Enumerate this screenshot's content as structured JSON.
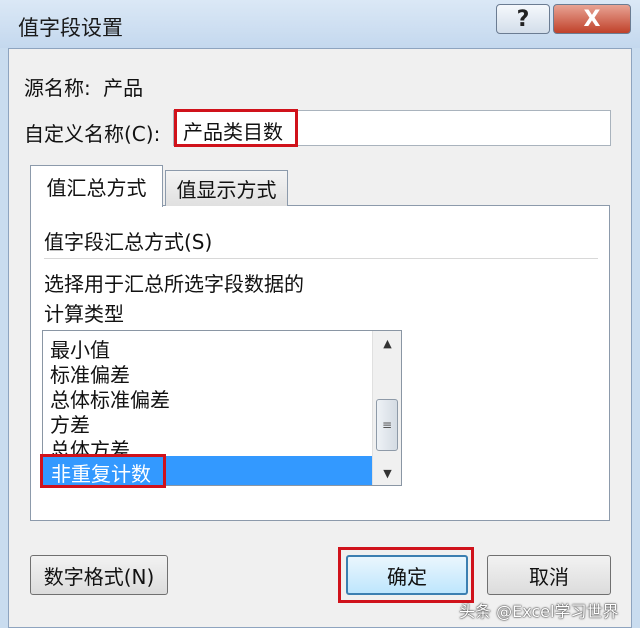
{
  "window": {
    "title": "值字段设置",
    "help_label": "?",
    "close_label": "X"
  },
  "source": {
    "label": "源名称:",
    "value": "产品"
  },
  "custom_name": {
    "label": "自定义名称(C):",
    "value": "产品类目数"
  },
  "tabs": [
    {
      "label": "值汇总方式",
      "active": true
    },
    {
      "label": "值显示方式",
      "active": false
    }
  ],
  "summary": {
    "group_label": "值字段汇总方式(S)",
    "description_line1": "选择用于汇总所选字段数据的",
    "description_line2": "计算类型",
    "items": [
      "最小值",
      "标准偏差",
      "总体标准偏差",
      "方差",
      "总体方差"
    ],
    "selected_item": "非重复计数"
  },
  "buttons": {
    "number_format": "数字格式(N)",
    "ok": "确定",
    "cancel": "取消"
  },
  "watermark": "头条 @Excel学习世界",
  "colors": {
    "selection": "#3399ff",
    "highlight_box": "#d0121b"
  }
}
